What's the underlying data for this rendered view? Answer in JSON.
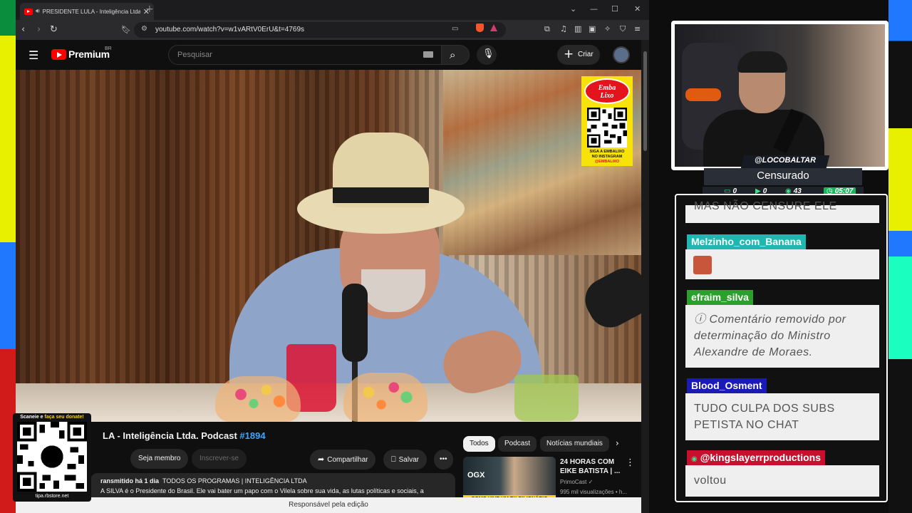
{
  "browser": {
    "tab_title": "PRESIDENTE LULA - Inteligência Ltda",
    "url": "youtube.com/watch?v=w1vARtV0ErU&t=4769s"
  },
  "youtube": {
    "logo_text": "Premium",
    "region": "BR",
    "search_placeholder": "Pesquisar",
    "create_label": "Criar",
    "sponsor": {
      "brand_line1": "Emba",
      "brand_line2": "Lixo",
      "caption_line1": "SIGA A EMBALIXO",
      "caption_line2": "NO INSTAGRAM",
      "handle": "@EMBALIXO"
    },
    "video": {
      "title": "LA - Inteligência Ltda. Podcast",
      "episode": "#1894",
      "join_label": "Seja membro",
      "subscribe_label": "Inscrever-se",
      "share_label": "Compartilhar",
      "save_label": "Salvar",
      "meta": "ransmitido há 1 dia",
      "categories": "TODOS OS PROGRAMAS | INTELIGÊNCIA LTDA",
      "description": "A SILVA é o Presidente do Brasil. Ele vai bater um papo com o Vilela sobre sua vida, as lutas políticas e sociais, a"
    },
    "chips": [
      "Todos",
      "Podcast",
      "Notícias mundiais"
    ],
    "recommended": {
      "title": "24 HORAS COM EIKE BATISTA | ...",
      "channel": "PrimoCast",
      "views": "995 mil visualizações • h...",
      "thumb_text": "COMO VIVE UM EX-BILIONÁRIO",
      "thumb_logo": "OGX"
    },
    "status_bar": "Responsável pela edição"
  },
  "donate": {
    "header_pre": "Scaneie e ",
    "header_highlight": "faça seu donate!",
    "footer": "tipa.rbstore.net"
  },
  "stream": {
    "handle": "@LOCOBALTAR",
    "title": "Censurado",
    "stats": [
      "0",
      "0",
      "43",
      "05:07"
    ]
  },
  "chat": {
    "partial_text": "MAS NÃO CENSURE ELE",
    "messages": [
      {
        "user": "Melzinho_com_Banana",
        "color": "#1fb8b0",
        "text": ""
      },
      {
        "user": "efraim_silva",
        "color": "#2ca02c",
        "text_line1": "ⓘ Comentário removido por",
        "text_line2": "determinação do Ministro",
        "text_line3": "Alexandre de Moraes."
      },
      {
        "user": "Blood_Osment",
        "color": "#1a1ab8",
        "text_line1": "TUDO CULPA DOS SUBS",
        "text_line2": "PETISTA NO CHAT"
      },
      {
        "user": "@kingslayerrproductions",
        "color": "#c8102e",
        "text": "voltou"
      }
    ]
  }
}
